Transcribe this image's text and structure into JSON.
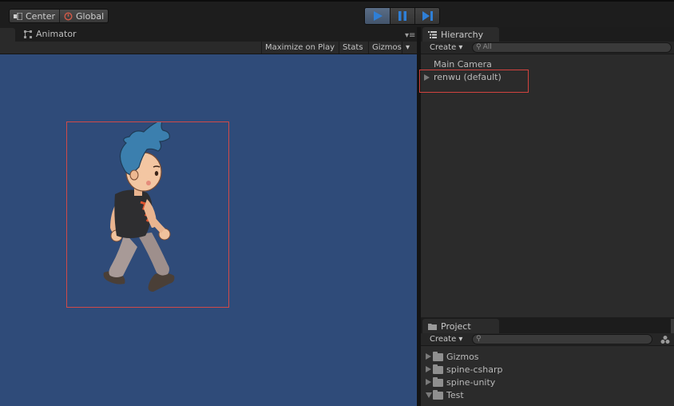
{
  "toolbar": {
    "pivot_center": "Center",
    "pivot_global": "Global"
  },
  "game": {
    "tab_label": "Animator",
    "maximize_on_play": "Maximize on Play",
    "stats": "Stats",
    "gizmos": "Gizmos"
  },
  "hierarchy": {
    "tab_label": "Hierarchy",
    "create_label": "Create",
    "search_placeholder": "All",
    "items": [
      {
        "label": "Main Camera"
      },
      {
        "label": "renwu (default)"
      }
    ]
  },
  "project": {
    "tab_label": "Project",
    "create_label": "Create",
    "items": [
      {
        "label": "Gizmos"
      },
      {
        "label": "spine-csharp"
      },
      {
        "label": "spine-unity"
      },
      {
        "label": "Test"
      }
    ]
  },
  "colors": {
    "game_background": "#2f4b79",
    "selection_outline": "#d04a48",
    "play_accent": "#2f7fd6"
  }
}
